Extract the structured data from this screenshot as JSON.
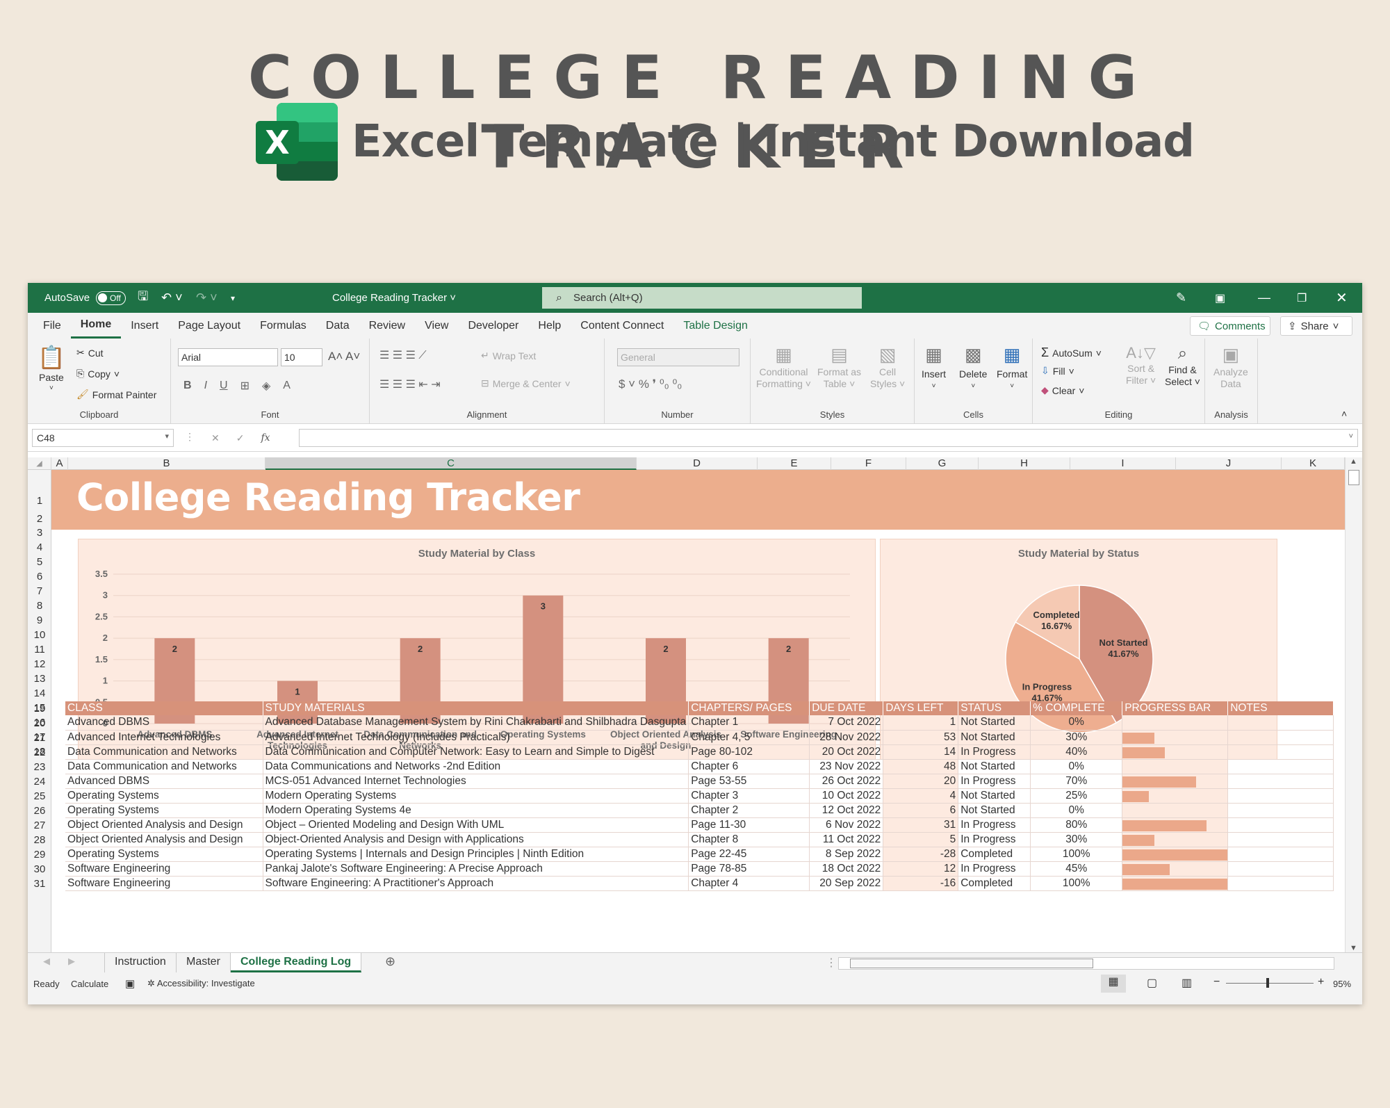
{
  "hero": {
    "title": "COLLEGE READING TRACKER",
    "subtitle": "Excel Template | Instant Download",
    "logo_letter": "X"
  },
  "window": {
    "autosave_label": "AutoSave",
    "autosave_state": "Off",
    "doc_title": "College Reading Tracker",
    "search_placeholder": "Search (Alt+Q)",
    "menu": [
      "File",
      "Home",
      "Insert",
      "Page Layout",
      "Formulas",
      "Data",
      "Review",
      "View",
      "Developer",
      "Help",
      "Content Connect",
      "Table Design"
    ],
    "comments_label": "Comments",
    "share_label": "Share"
  },
  "ribbon": {
    "clipboard": {
      "paste": "Paste",
      "cut": "Cut",
      "copy": "Copy",
      "format_painter": "Format Painter",
      "label": "Clipboard"
    },
    "font": {
      "name": "Arial",
      "size": "10",
      "label": "Font"
    },
    "alignment": {
      "wrap": "Wrap Text",
      "merge": "Merge & Center",
      "label": "Alignment"
    },
    "number": {
      "format": "General",
      "label": "Number"
    },
    "styles": {
      "cond1": "Conditional",
      "cond2": "Formatting",
      "fmt1": "Format as",
      "fmt2": "Table",
      "cell1": "Cell",
      "cell2": "Styles",
      "label": "Styles"
    },
    "cells": {
      "insert": "Insert",
      "delete": "Delete",
      "format": "Format",
      "label": "Cells"
    },
    "editing": {
      "autosum": "AutoSum",
      "fill": "Fill",
      "clear": "Clear",
      "sort1": "Sort &",
      "sort2": "Filter",
      "find1": "Find &",
      "find2": "Select",
      "label": "Editing"
    },
    "analysis": {
      "a1": "Analyze",
      "a2": "Data",
      "label": "Analysis"
    }
  },
  "formula_bar": {
    "name_box": "C48",
    "fx": "fx",
    "content": ""
  },
  "columns": [
    "A",
    "B",
    "C",
    "D",
    "E",
    "F",
    "G",
    "H",
    "I",
    "J",
    "K"
  ],
  "sheet": {
    "banner_title": "College Reading Tracker",
    "table": {
      "headers": [
        "CLASS",
        "STUDY MATERIALS",
        "CHAPTERS/ PAGES",
        "DUE DATE",
        "DAYS LEFT",
        "STATUS",
        "% COMPLETE",
        "PROGRESS BAR",
        "NOTES"
      ],
      "rows": [
        {
          "row": "20",
          "class": "Advanced DBMS",
          "material": "Advanced Database Management System by Rini Chakrabarti and Shilbhadra Dasgupta",
          "chapters": "Chapter 1",
          "due": "7 Oct 2022",
          "days": "1",
          "status": "Not Started",
          "pct": "0%",
          "progress": 0
        },
        {
          "row": "21",
          "class": "Advanced Internet Technologies",
          "material": "Advanced Internet Technology (Includes Practicals)",
          "chapters": "Chapter 4, 5",
          "due": "28 Nov 2022",
          "days": "53",
          "status": "Not Started",
          "pct": "30%",
          "progress": 0.3
        },
        {
          "row": "22",
          "class": "Data Communication and Networks",
          "material": "Data Communication and Computer Network: Easy to Learn and Simple to Digest",
          "chapters": "Page 80-102",
          "due": "20 Oct 2022",
          "days": "14",
          "status": "In Progress",
          "pct": "40%",
          "progress": 0.4
        },
        {
          "row": "23",
          "class": "Data Communication and Networks",
          "material": "Data Communications and Networks -2nd Edition",
          "chapters": "Chapter 6",
          "due": "23 Nov 2022",
          "days": "48",
          "status": "Not Started",
          "pct": "0%",
          "progress": 0
        },
        {
          "row": "24",
          "class": "Advanced DBMS",
          "material": "MCS-051 Advanced Internet Technologies",
          "chapters": "Page 53-55",
          "due": "26 Oct 2022",
          "days": "20",
          "status": "In Progress",
          "pct": "70%",
          "progress": 0.7
        },
        {
          "row": "25",
          "class": "Operating Systems",
          "material": "Modern Operating Systems",
          "chapters": "Chapter 3",
          "due": "10 Oct 2022",
          "days": "4",
          "status": "Not Started",
          "pct": "25%",
          "progress": 0.25
        },
        {
          "row": "26",
          "class": "Operating Systems",
          "material": "Modern Operating Systems 4e",
          "chapters": "Chapter 2",
          "due": "12 Oct 2022",
          "days": "6",
          "status": "Not Started",
          "pct": "0%",
          "progress": 0
        },
        {
          "row": "27",
          "class": "Object Oriented Analysis and Design",
          "material": "Object – Oriented Modeling and Design With UML",
          "chapters": "Page 11-30",
          "due": "6 Nov 2022",
          "days": "31",
          "status": "In Progress",
          "pct": "80%",
          "progress": 0.8
        },
        {
          "row": "28",
          "class": "Object Oriented Analysis and Design",
          "material": "Object-Oriented Analysis and Design with Applications",
          "chapters": "Chapter 8",
          "due": "11 Oct 2022",
          "days": "5",
          "status": "In Progress",
          "pct": "30%",
          "progress": 0.3
        },
        {
          "row": "29",
          "class": "Operating Systems",
          "material": "Operating Systems | Internals and Design Principles | Ninth Edition",
          "chapters": "Page 22-45",
          "due": "8 Sep 2022",
          "days": "-28",
          "status": "Completed",
          "pct": "100%",
          "progress": 1
        },
        {
          "row": "30",
          "class": "Software Engineering",
          "material": "Pankaj Jalote's Software Engineering: A Precise Approach",
          "chapters": "Page 78-85",
          "due": "18 Oct 2022",
          "days": "12",
          "status": "In Progress",
          "pct": "45%",
          "progress": 0.45
        },
        {
          "row": "31",
          "class": "Software Engineering",
          "material": "Software Engineering: A Practitioner's Approach",
          "chapters": "Chapter 4",
          "due": "20 Sep 2022",
          "days": "-16",
          "status": "Completed",
          "pct": "100%",
          "progress": 1
        }
      ]
    }
  },
  "chart_data": [
    {
      "type": "bar",
      "title": "Study Material by Class",
      "categories": [
        "Advanced DBMS",
        "Advanced Internet Technologies",
        "Data Communication and Networks",
        "Operating Systems",
        "Object Oriented Analysis and Design",
        "Software Engineering"
      ],
      "category_lines": [
        [
          "Advanced DBMS"
        ],
        [
          "Advanced Internet",
          "Technologies"
        ],
        [
          "Data Communication and",
          "Networks"
        ],
        [
          "Operating Systems"
        ],
        [
          "Object Oriented Analysis",
          "and Design"
        ],
        [
          "Software Engineering"
        ]
      ],
      "values": [
        2,
        1,
        2,
        3,
        2,
        2
      ],
      "ylim": [
        0,
        3.5
      ],
      "yticks": [
        "0",
        "0.5",
        "1",
        "1.5",
        "2",
        "2.5",
        "3",
        "3.5"
      ],
      "grid": true,
      "color": "#d4917f"
    },
    {
      "type": "pie",
      "title": "Study Material by Status",
      "slices": [
        {
          "label": "Not Started",
          "value": 41.67,
          "pct_label": "41.67%",
          "color": "#d4917f"
        },
        {
          "label": "In Progress",
          "value": 41.67,
          "pct_label": "41.67%",
          "color": "#eeae90"
        },
        {
          "label": "Completed",
          "value": 16.67,
          "pct_label": "16.67%",
          "color": "#f5c9b3"
        }
      ]
    }
  ],
  "sheet_tabs": [
    "Instruction",
    "Master",
    "College Reading Log"
  ],
  "status_bar": {
    "ready": "Ready",
    "calculate": "Calculate",
    "accessibility": "Accessibility: Investigate",
    "zoom": "95%"
  },
  "colors": {
    "excel_green": "#1e7145",
    "banner": "#ecae8d",
    "header": "#d7927a",
    "chart_bg": "#fdeae0"
  }
}
